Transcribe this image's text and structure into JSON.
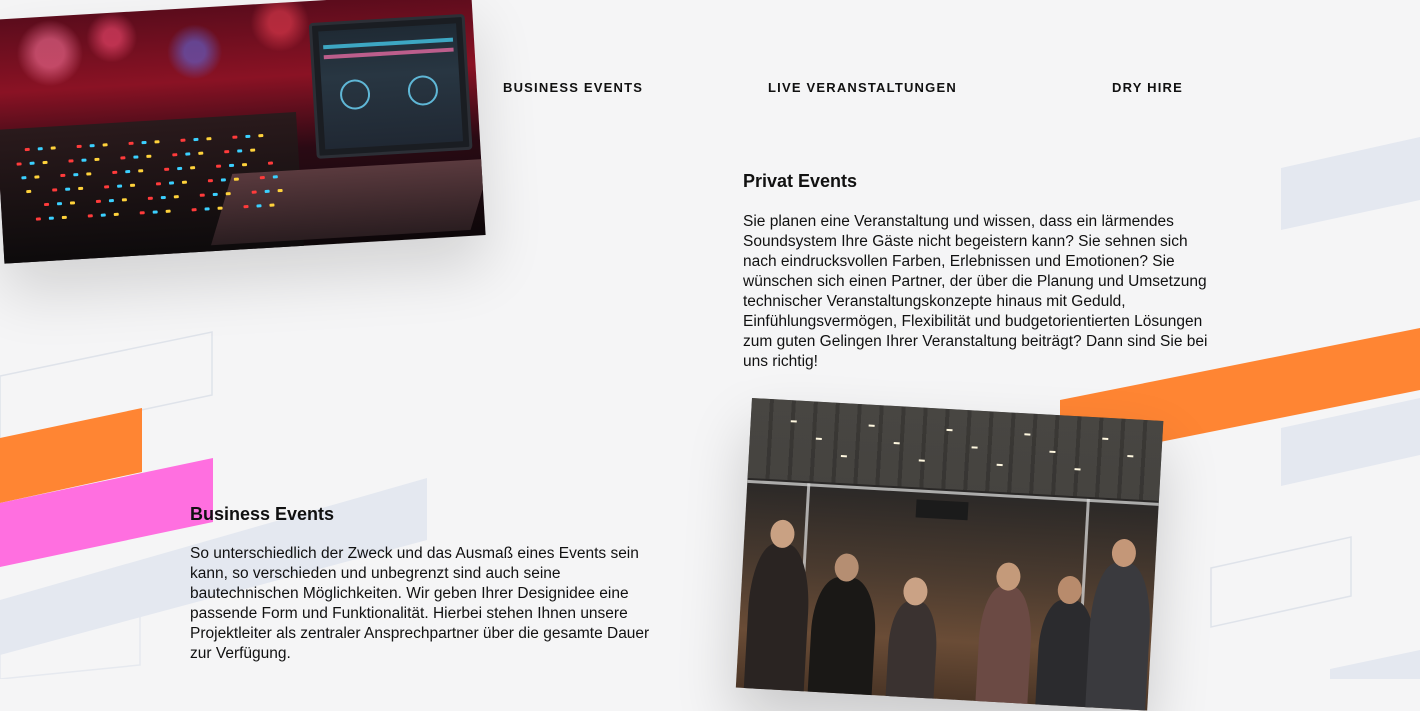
{
  "nav": {
    "items": [
      {
        "label": "BUSINESS EVENTS"
      },
      {
        "label": "LIVE VERANSTALTUNGEN"
      },
      {
        "label": "DRY HIRE"
      }
    ]
  },
  "privat": {
    "title": "Privat Events",
    "text": "Sie planen eine Veranstaltung und wissen, dass ein lärmendes Soundsystem Ihre Gäste nicht begeistern kann? Sie sehnen sich nach eindrucksvollen Farben, Erlebnissen und Emotionen? Sie wünschen sich einen Partner, der über die Planung und Umsetzung technischer Veranstaltungskonzepte hinaus mit Geduld, Einfühlungsvermögen, Flexibilität und budgetorientierten Lösungen zum guten Gelingen Ihrer Veranstaltung beiträgt? Dann sind Sie bei uns richtig!"
  },
  "business": {
    "title": "Business Events",
    "text": "So unterschiedlich der Zweck und das Ausmaß eines Events sein kann, so verschieden und unbegrenzt sind auch seine bautechnischen Möglichkeiten. Wir geben Ihrer Designidee eine passende Form und Funktionalität. Hierbei stehen Ihnen unsere Projektleiter als zentraler Ansprechpartner über die gesamte Dauer zur Verfügung."
  },
  "images": {
    "dj": "dj-mixer-laptop-photo",
    "expo": "exhibition-hall-photo"
  },
  "colors": {
    "background": "#f5f5f6",
    "orange": "#ff8533",
    "pink": "#ff6fe0",
    "pale_blue": "#e4e8f0",
    "text": "#111111"
  }
}
